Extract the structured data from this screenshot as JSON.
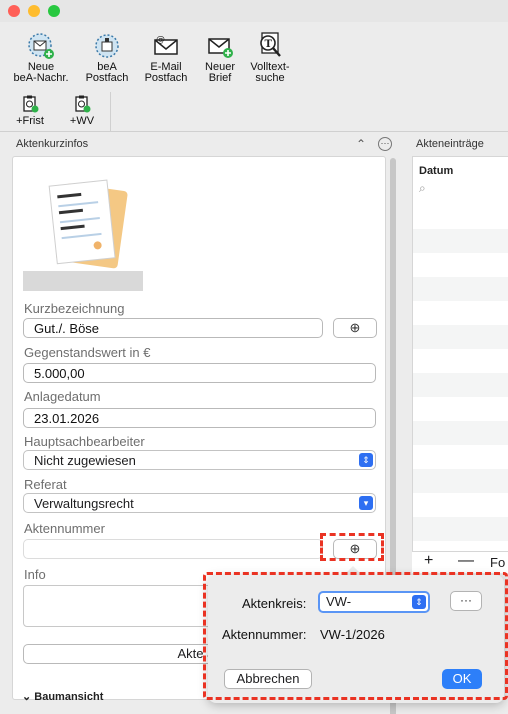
{
  "window": {
    "traffic_lights": [
      "close",
      "minimize",
      "zoom"
    ]
  },
  "toolbar": {
    "row1": [
      {
        "label": "Neue\nbeA-Nachr.",
        "icon": "bea-new-message-icon"
      },
      {
        "label": "beA\nPostfach",
        "icon": "bea-mailbox-icon"
      },
      {
        "label": "E-Mail\nPostfach",
        "icon": "email-icon"
      },
      {
        "label": "Neuer\nBrief",
        "icon": "new-letter-icon"
      },
      {
        "label": "Volltext-\nsuche",
        "icon": "fulltext-search-icon"
      }
    ],
    "row2": [
      {
        "label": "+Frist",
        "icon": "deadline-clipboard-icon"
      },
      {
        "label": "+WV",
        "icon": "resubmission-clipboard-icon"
      }
    ]
  },
  "left_panel": {
    "title": "Aktenkurzinfos",
    "collapse_glyph": "⌃",
    "more_glyph": "···",
    "fields": {
      "kurzbezeichnung": {
        "label": "Kurzbezeichnung",
        "value": "Gut./. Böse"
      },
      "gegenstandswert": {
        "label": "Gegenstandswert in €",
        "value": "5.000,00"
      },
      "anlagedatum": {
        "label": "Anlagedatum",
        "value": "23.01.2026"
      },
      "hauptsachbearbeiter": {
        "label": "Hauptsachbearbeiter",
        "value": "Nicht zugewiesen"
      },
      "referat": {
        "label": "Referat",
        "value": "Verwaltungsrecht"
      },
      "aktennummer": {
        "label": "Aktennummer",
        "value": ""
      },
      "info": {
        "label": "Info"
      }
    },
    "akte_button": "Akte ab",
    "tree_label": "Baumansicht"
  },
  "right_panel": {
    "title": "Akteneinträge",
    "column": "Datum",
    "bottom_plus": "+",
    "bottom_minus": "—",
    "bottom_partial": "Fo"
  },
  "popover": {
    "aktenkreis_label": "Aktenkreis:",
    "aktenkreis_value": "VW-",
    "aktennummer_label": "Aktennummer:",
    "aktennummer_value": "VW-1/2026",
    "cancel": "Abbrechen",
    "ok": "OK",
    "more_glyph": "···"
  },
  "colors": {
    "accent": "#2d7ff9",
    "highlight": "#ea3323"
  }
}
